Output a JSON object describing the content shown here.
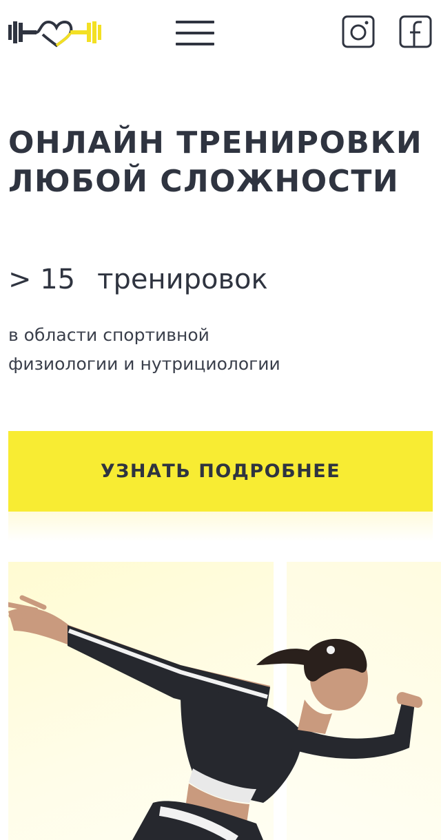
{
  "header": {
    "logo_icon": "dumbbell-heart-logo",
    "menu_icon": "hamburger-menu-icon",
    "social": [
      {
        "icon": "instagram-icon"
      },
      {
        "icon": "facebook-icon"
      }
    ]
  },
  "hero": {
    "title_line1": "ОНЛАЙН ТРЕНИРОВКИ",
    "title_line2": "ЛЮБОЙ СЛОЖНОСТИ",
    "stat_number": "> 15",
    "stat_label": "тренировок",
    "desc_line1": "в области спортивной",
    "desc_line2": "физиологии и нутрициологии",
    "cta_label": "УЗНАТЬ ПОДРОБНЕЕ"
  },
  "colors": {
    "accent": "#f8ec33",
    "text": "#2f3440",
    "photo_bg": "#fffbd8"
  }
}
